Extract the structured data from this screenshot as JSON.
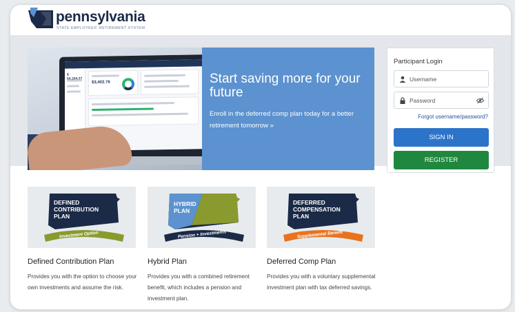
{
  "header": {
    "logo_text": "pennsylvania",
    "logo_subtitle": "STATE EMPLOYEES' RETIREMENT SYSTEM"
  },
  "hero": {
    "title": "Start saving more for your future",
    "subtitle": "Enroll in the deferred comp plan today for a better retirement tomorrow »",
    "screen_values": [
      "$ 64,204.37",
      "$3,402.76"
    ]
  },
  "login": {
    "title": "Participant Login",
    "username_placeholder": "Username",
    "password_placeholder": "Password",
    "forgot_link": "Forgot username/password?",
    "signin_label": "SIGN IN",
    "register_label": "REGISTER"
  },
  "plans": [
    {
      "badge_lines": [
        "DEFINED",
        "CONTRIBUTION",
        "PLAN"
      ],
      "ribbon": "Investment Option",
      "ribbon_color": "#8a9a2e",
      "title": "Defined Contribution Plan",
      "description": "Provides you with the option to choose your own investments and assume the risk."
    },
    {
      "badge_lines": [
        "HYBRID",
        "PLAN"
      ],
      "ribbon": "Pension + Investments",
      "ribbon_color": "#1b2a47",
      "title": "Hybrid Plan",
      "description": "Provides you with a combined retirement benefit, which includes a pension and investment plan."
    },
    {
      "badge_lines": [
        "DEFERRED",
        "COMPENSATION",
        "PLAN"
      ],
      "ribbon": "Supplemental Benefit",
      "ribbon_color": "#e8731f",
      "title": "Deferred Comp Plan",
      "description": "Provides you with a voluntary supplemental investment plan with tax deferred savings."
    }
  ],
  "colors": {
    "navy": "#1b2a47",
    "hero_blue": "#5b92cf",
    "signin_blue": "#2b74c9",
    "register_green": "#20873e",
    "link_blue": "#1f4e9e"
  },
  "icons": [
    "keystone-logo-icon",
    "user-icon",
    "lock-icon",
    "eye-slash-icon"
  ]
}
